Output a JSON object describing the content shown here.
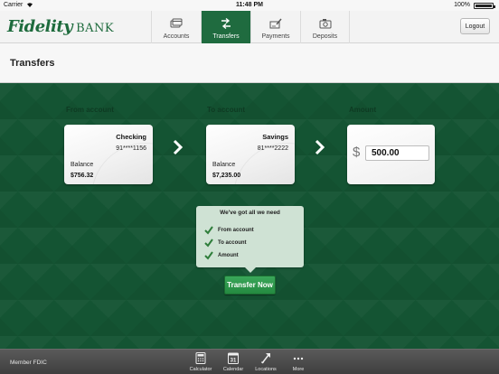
{
  "status_bar": {
    "carrier": "Carrier",
    "time": "11:48 PM",
    "battery": "100%"
  },
  "header": {
    "logo_script": "Fidelity",
    "logo_bank": "BANK",
    "tabs": [
      {
        "label": "Accounts",
        "icon": "accounts-icon"
      },
      {
        "label": "Transfers",
        "icon": "transfer-arrows-icon",
        "active": true
      },
      {
        "label": "Payments",
        "icon": "payments-icon"
      },
      {
        "label": "Deposits",
        "icon": "camera-icon"
      }
    ],
    "logout_label": "Logout"
  },
  "page_title": "Transfers",
  "from": {
    "section_label": "From account",
    "account_name": "Checking",
    "account_number": "91****1156",
    "balance_label": "Balance",
    "balance": "$756.32"
  },
  "to": {
    "section_label": "To account",
    "account_name": "Savings",
    "account_number": "81****2222",
    "balance_label": "Balance",
    "balance": "$7,235.00"
  },
  "amount": {
    "section_label": "Amount",
    "currency_symbol": "$",
    "value": "500.00"
  },
  "checklist": {
    "title": "We've got all we need",
    "items": [
      "From account",
      "To account",
      "Amount"
    ]
  },
  "transfer_button": "Transfer Now",
  "footer": {
    "member": "Member FDIC",
    "tools": [
      {
        "label": "Calculator",
        "icon": "calculator-icon"
      },
      {
        "label": "Calendar",
        "icon": "calendar-icon",
        "icon_text": "31"
      },
      {
        "label": "Locations",
        "icon": "locations-icon"
      },
      {
        "label": "More",
        "icon": "more-icon"
      }
    ]
  },
  "colors": {
    "brand_green": "#1f6b3f",
    "background_green": "#145433",
    "check_green": "#2e7d3a"
  }
}
